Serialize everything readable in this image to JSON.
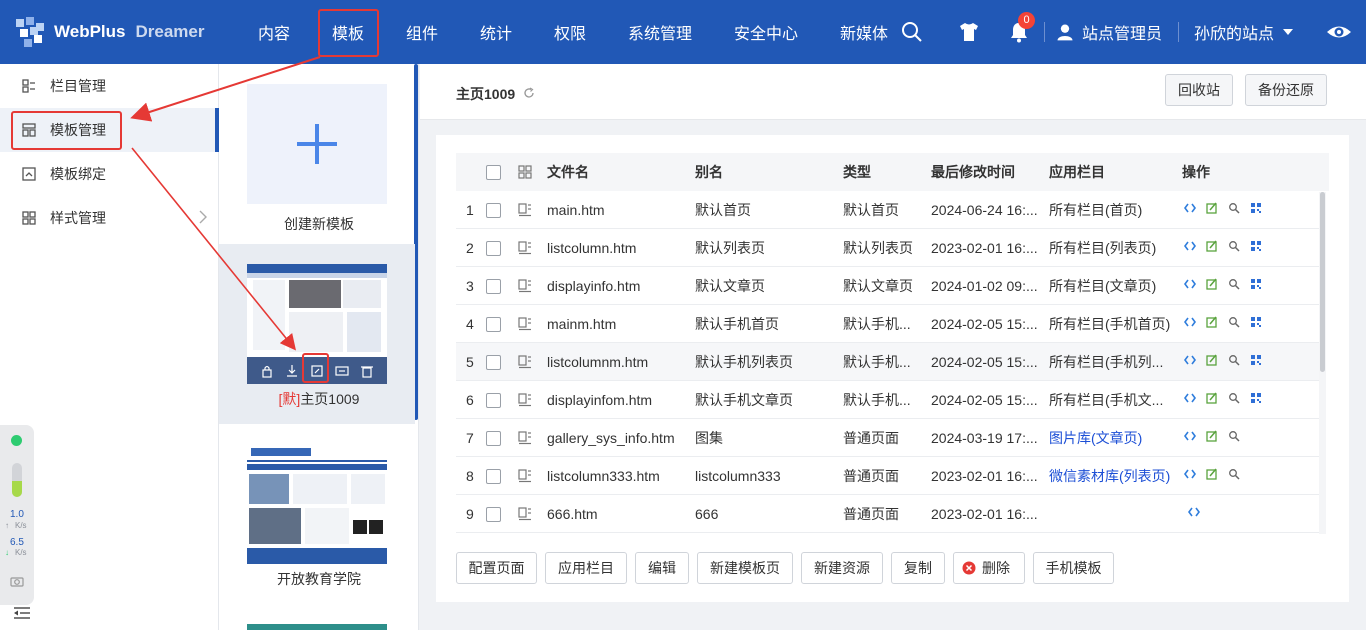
{
  "brand": {
    "name": "WebPlus",
    "product": "Dreamer"
  },
  "nav": {
    "items": [
      "内容",
      "模板",
      "组件",
      "统计",
      "权限",
      "系统管理",
      "安全中心",
      "新媒体"
    ],
    "notification_count": "0",
    "user": "站点管理员",
    "site": "孙欣的站点"
  },
  "sidebar": {
    "items": [
      {
        "label": "栏目管理"
      },
      {
        "label": "模板管理"
      },
      {
        "label": "模板绑定"
      },
      {
        "label": "样式管理"
      }
    ]
  },
  "templates": {
    "create_label": "创建新模板",
    "items": [
      {
        "prefix": "[默]",
        "name": "主页1009"
      },
      {
        "name": "开放教育学院"
      }
    ]
  },
  "speed_widget": {
    "up": "1.0",
    "up_unit": "K/s",
    "down": "6.5",
    "down_unit": "K/s"
  },
  "main": {
    "title": "主页1009",
    "recycle_label": "回收站",
    "backup_label": "备份还原"
  },
  "table": {
    "headers": {
      "filename": "文件名",
      "alias": "别名",
      "type": "类型",
      "modified": "最后修改时间",
      "column": "应用栏目",
      "ops": "操作"
    },
    "rows": [
      {
        "n": "1",
        "file": "main.htm",
        "alias": "默认首页",
        "type": "默认首页",
        "time": "2024-06-24 16:...",
        "col": "所有栏目(首页)",
        "col_link": false,
        "ops": 4
      },
      {
        "n": "2",
        "file": "listcolumn.htm",
        "alias": "默认列表页",
        "type": "默认列表页",
        "time": "2023-02-01 16:...",
        "col": "所有栏目(列表页)",
        "col_link": false,
        "ops": 4
      },
      {
        "n": "3",
        "file": "displayinfo.htm",
        "alias": "默认文章页",
        "type": "默认文章页",
        "time": "2024-01-02 09:...",
        "col": "所有栏目(文章页)",
        "col_link": false,
        "ops": 4
      },
      {
        "n": "4",
        "file": "mainm.htm",
        "alias": "默认手机首页",
        "type": "默认手机...",
        "time": "2024-02-05 15:...",
        "col": "所有栏目(手机首页)",
        "col_link": false,
        "ops": 4
      },
      {
        "n": "5",
        "file": "listcolumnm.htm",
        "alias": "默认手机列表页",
        "type": "默认手机...",
        "time": "2024-02-05 15:...",
        "col": "所有栏目(手机列...",
        "col_link": false,
        "ops": 4
      },
      {
        "n": "6",
        "file": "displayinfom.htm",
        "alias": "默认手机文章页",
        "type": "默认手机...",
        "time": "2024-02-05 15:...",
        "col": "所有栏目(手机文...",
        "col_link": false,
        "ops": 4
      },
      {
        "n": "7",
        "file": "gallery_sys_info.htm",
        "alias": "图集",
        "type": "普通页面",
        "time": "2024-03-19 17:...",
        "col": "图片库(文章页)",
        "col_link": true,
        "ops": 3
      },
      {
        "n": "8",
        "file": "listcolumn333.htm",
        "alias": "listcolumn333",
        "type": "普通页面",
        "time": "2023-02-01 16:...",
        "col": "微信素材库(列表页)",
        "col_link": true,
        "ops": 3
      },
      {
        "n": "9",
        "file": "666.htm",
        "alias": "666",
        "type": "普通页面",
        "time": "2023-02-01 16:...",
        "col": "",
        "col_link": false,
        "ops": 1
      }
    ]
  },
  "actions": [
    "配置页面",
    "应用栏目",
    "编辑",
    "新建模板页",
    "新建资源",
    "复制",
    "删除",
    "手机模板"
  ]
}
